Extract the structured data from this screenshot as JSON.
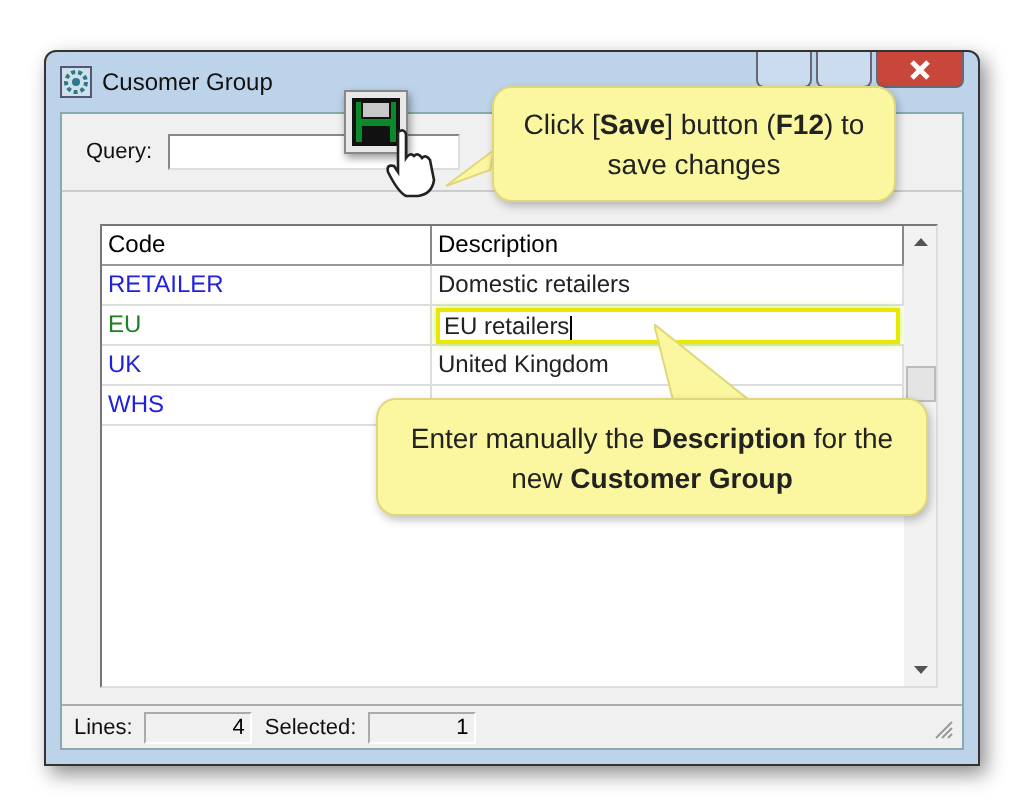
{
  "window": {
    "title": "Cusomer Group"
  },
  "query": {
    "label": "Query:"
  },
  "table": {
    "columns": [
      "Code",
      "Description"
    ],
    "rows": [
      {
        "code": "RETAILER",
        "description": "Domestic retailers",
        "color": "#2020e0",
        "editing": false
      },
      {
        "code": "EU",
        "description": "EU retailers",
        "color": "#208020",
        "editing": true
      },
      {
        "code": "UK",
        "description": "United Kingdom",
        "color": "#2020e0",
        "editing": false
      },
      {
        "code": "WHS",
        "color": "#2020e0",
        "editing": false
      }
    ]
  },
  "status_bar": {
    "lines_label": "Lines:",
    "lines": "4",
    "selected_label": "Selected:",
    "selected": "1"
  },
  "callouts": [
    {
      "kind": "save",
      "text": "Click [**Save**] button (**F12**) to save changes"
    },
    {
      "kind": "description",
      "text": "Enter manually the **Description** for the new **Customer Group**"
    }
  ]
}
